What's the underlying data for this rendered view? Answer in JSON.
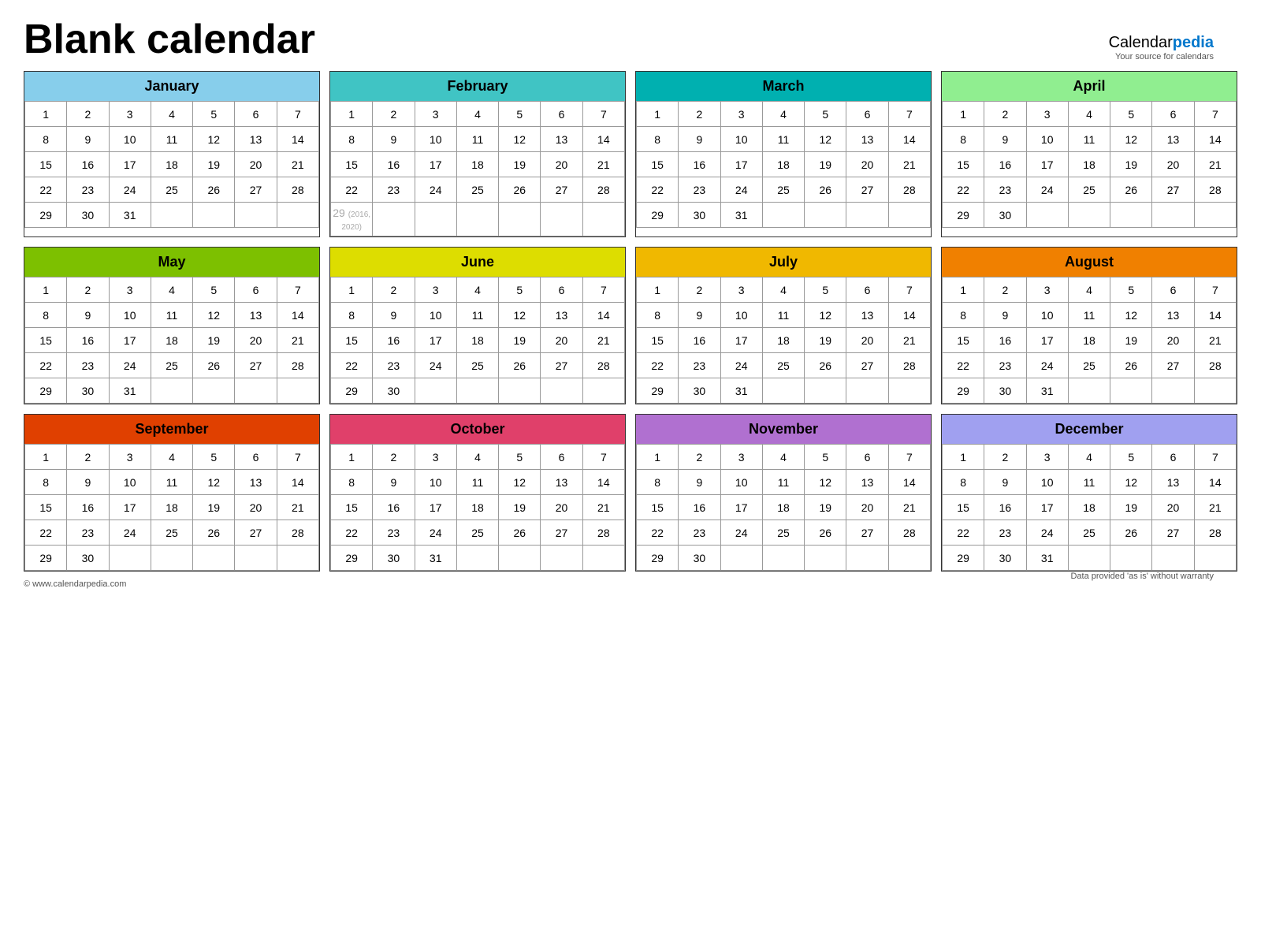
{
  "page": {
    "title": "Blank calendar",
    "logo_calendar": "Calendar",
    "logo_pedia": "pedia",
    "logo_sub": "Your source for calendars",
    "footer_left": "© www.calendarpedia.com",
    "footer_right": "Data provided 'as is' without warranty"
  },
  "months": [
    {
      "name": "January",
      "color": "#87CEEB",
      "days": 31,
      "start_day": 0,
      "rows": [
        [
          1,
          2,
          3,
          4,
          5,
          6,
          7
        ],
        [
          8,
          9,
          10,
          11,
          12,
          13,
          14
        ],
        [
          15,
          16,
          17,
          18,
          19,
          20,
          21
        ],
        [
          22,
          23,
          24,
          25,
          26,
          27,
          28
        ],
        [
          29,
          30,
          31,
          "",
          "",
          "",
          ""
        ]
      ]
    },
    {
      "name": "February",
      "color": "#40C4C4",
      "days": 28,
      "start_day": 0,
      "rows": [
        [
          1,
          2,
          3,
          4,
          5,
          6,
          7
        ],
        [
          8,
          9,
          10,
          11,
          12,
          13,
          14
        ],
        [
          15,
          16,
          17,
          18,
          19,
          20,
          21
        ],
        [
          22,
          23,
          24,
          25,
          26,
          27,
          28
        ],
        [
          "29_leap",
          "",
          "",
          "",
          "",
          "",
          ""
        ]
      ]
    },
    {
      "name": "March",
      "color": "#00B0B0",
      "days": 31,
      "start_day": 0,
      "rows": [
        [
          1,
          2,
          3,
          4,
          5,
          6,
          7
        ],
        [
          8,
          9,
          10,
          11,
          12,
          13,
          14
        ],
        [
          15,
          16,
          17,
          18,
          19,
          20,
          21
        ],
        [
          22,
          23,
          24,
          25,
          26,
          27,
          28
        ],
        [
          29,
          30,
          31,
          "",
          "",
          "",
          ""
        ]
      ]
    },
    {
      "name": "April",
      "color": "#90EE90",
      "days": 30,
      "start_day": 0,
      "rows": [
        [
          1,
          2,
          3,
          4,
          5,
          6,
          7
        ],
        [
          8,
          9,
          10,
          11,
          12,
          13,
          14
        ],
        [
          15,
          16,
          17,
          18,
          19,
          20,
          21
        ],
        [
          22,
          23,
          24,
          25,
          26,
          27,
          28
        ],
        [
          29,
          30,
          "",
          "",
          "",
          "",
          ""
        ]
      ]
    },
    {
      "name": "May",
      "color": "#7DC000",
      "days": 31,
      "start_day": 0,
      "rows": [
        [
          1,
          2,
          3,
          4,
          5,
          6,
          7
        ],
        [
          8,
          9,
          10,
          11,
          12,
          13,
          14
        ],
        [
          15,
          16,
          17,
          18,
          19,
          20,
          21
        ],
        [
          22,
          23,
          24,
          25,
          26,
          27,
          28
        ],
        [
          29,
          30,
          31,
          "",
          "",
          "",
          ""
        ]
      ]
    },
    {
      "name": "June",
      "color": "#DDDD00",
      "days": 30,
      "start_day": 0,
      "rows": [
        [
          1,
          2,
          3,
          4,
          5,
          6,
          7
        ],
        [
          8,
          9,
          10,
          11,
          12,
          13,
          14
        ],
        [
          15,
          16,
          17,
          18,
          19,
          20,
          21
        ],
        [
          22,
          23,
          24,
          25,
          26,
          27,
          28
        ],
        [
          29,
          30,
          "",
          "",
          "",
          "",
          ""
        ]
      ]
    },
    {
      "name": "July",
      "color": "#F0B800",
      "days": 31,
      "start_day": 0,
      "rows": [
        [
          1,
          2,
          3,
          4,
          5,
          6,
          7
        ],
        [
          8,
          9,
          10,
          11,
          12,
          13,
          14
        ],
        [
          15,
          16,
          17,
          18,
          19,
          20,
          21
        ],
        [
          22,
          23,
          24,
          25,
          26,
          27,
          28
        ],
        [
          29,
          30,
          31,
          "",
          "",
          "",
          ""
        ]
      ]
    },
    {
      "name": "August",
      "color": "#F08000",
      "days": 31,
      "start_day": 0,
      "rows": [
        [
          1,
          2,
          3,
          4,
          5,
          6,
          7
        ],
        [
          8,
          9,
          10,
          11,
          12,
          13,
          14
        ],
        [
          15,
          16,
          17,
          18,
          19,
          20,
          21
        ],
        [
          22,
          23,
          24,
          25,
          26,
          27,
          28
        ],
        [
          29,
          30,
          31,
          "",
          "",
          "",
          ""
        ]
      ]
    },
    {
      "name": "September",
      "color": "#E04000",
      "days": 30,
      "start_day": 0,
      "rows": [
        [
          1,
          2,
          3,
          4,
          5,
          6,
          7
        ],
        [
          8,
          9,
          10,
          11,
          12,
          13,
          14
        ],
        [
          15,
          16,
          17,
          18,
          19,
          20,
          21
        ],
        [
          22,
          23,
          24,
          25,
          26,
          27,
          28
        ],
        [
          29,
          30,
          "",
          "",
          "",
          "",
          ""
        ]
      ]
    },
    {
      "name": "October",
      "color": "#E0406A",
      "days": 31,
      "start_day": 0,
      "rows": [
        [
          1,
          2,
          3,
          4,
          5,
          6,
          7
        ],
        [
          8,
          9,
          10,
          11,
          12,
          13,
          14
        ],
        [
          15,
          16,
          17,
          18,
          19,
          20,
          21
        ],
        [
          22,
          23,
          24,
          25,
          26,
          27,
          28
        ],
        [
          29,
          30,
          31,
          "",
          "",
          "",
          ""
        ]
      ]
    },
    {
      "name": "November",
      "color": "#B070D0",
      "days": 30,
      "start_day": 0,
      "rows": [
        [
          1,
          2,
          3,
          4,
          5,
          6,
          7
        ],
        [
          8,
          9,
          10,
          11,
          12,
          13,
          14
        ],
        [
          15,
          16,
          17,
          18,
          19,
          20,
          21
        ],
        [
          22,
          23,
          24,
          25,
          26,
          27,
          28
        ],
        [
          29,
          30,
          "",
          "",
          "",
          "",
          ""
        ]
      ]
    },
    {
      "name": "December",
      "color": "#A0A0F0",
      "days": 31,
      "start_day": 0,
      "rows": [
        [
          1,
          2,
          3,
          4,
          5,
          6,
          7
        ],
        [
          8,
          9,
          10,
          11,
          12,
          13,
          14
        ],
        [
          15,
          16,
          17,
          18,
          19,
          20,
          21
        ],
        [
          22,
          23,
          24,
          25,
          26,
          27,
          28
        ],
        [
          29,
          30,
          31,
          "",
          "",
          "",
          ""
        ]
      ]
    }
  ]
}
